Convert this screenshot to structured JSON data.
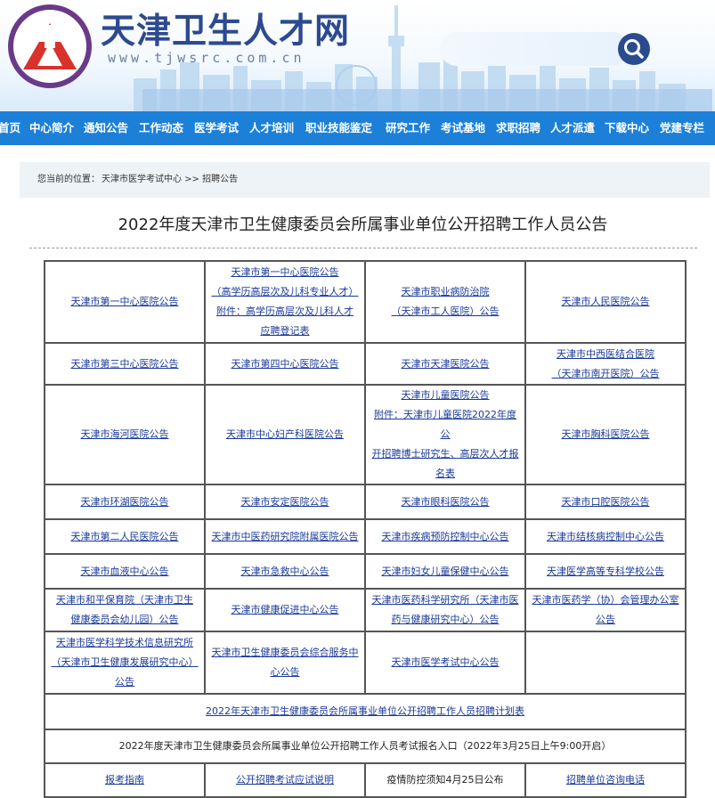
{
  "header": {
    "title": "天津卫生人才网",
    "url": "www.tjwsrc.com.cn"
  },
  "colors": {
    "nav_bg": "#1c80d8",
    "link": "#1a3a9a",
    "logo_ring": "#c0392b",
    "brand_blue": "#2d4a8f"
  },
  "nav": [
    "首页",
    "中心简介",
    "通知公告",
    "工作动态",
    "医学考试",
    "人才培训",
    "职业技能鉴定",
    "研究工作",
    "考试基地",
    "求职招聘",
    "人才派遣",
    "下载中心",
    "党建专栏"
  ],
  "breadcrumb": {
    "label": "您当前的位置：",
    "path": "天津市医学考试中心 >> 招聘公告"
  },
  "page_title": "2022年度天津市卫生健康委员会所属事业单位公开招聘工作人员公告",
  "grid": {
    "r1": [
      "天津市第一中心医院公告",
      "天津市第一中心医院公告",
      "（高学历高层次及儿科专业人才）",
      "附件：高学历高层次及儿科人才",
      "应聘登记表",
      "天津市职业病防治院",
      "（天津市工人医院）公告",
      "天津市人民医院公告"
    ],
    "r2": [
      "天津市第三中心医院公告",
      "天津市第四中心医院公告",
      "天津市天津医院公告",
      "天津市中西医结合医院",
      "（天津市南开医院）公告"
    ],
    "r3": [
      "天津市海河医院公告",
      "天津市中心妇产科医院公告",
      "天津市儿童医院公告",
      "附件：天津市儿童医院2022年度公",
      "开招聘博士研究生、高层次人才报",
      "名表",
      "天津市胸科医院公告"
    ],
    "r4": [
      "天津市环湖医院公告",
      "天津市安定医院公告",
      "天津市眼科医院公告",
      "天津市口腔医院公告"
    ],
    "r5": [
      "天津市第二人民医院公告",
      "天津市中医药研究院附属医院公告",
      "天津市疾病预防控制中心公告",
      "天津市结核病控制中心公告"
    ],
    "r6": [
      "天津市血液中心公告",
      "天津市急救中心公告",
      "天津市妇女儿童保健中心公告",
      "天津医学高等专科学校公告"
    ],
    "r7": [
      "天津市和平保育院（天津市卫生",
      "健康委员会幼儿园）公告",
      "天津市健康促进中心公告",
      "天津市医药科学研究所（天津市医",
      "药与健康研究中心）公告",
      "天津市医药学（协）会管理办公室",
      "公告"
    ],
    "r8": [
      "天津市医学科学技术信息研究所",
      "（天津市卫生健康发展研究中心）",
      "公告",
      "天津市卫生健康委员会综合服务中",
      "心公告",
      "天津市医学考试中心公告"
    ],
    "plan": "2022年天津市卫生健康委员会所属事业单位公开招聘工作人员招聘计划表",
    "entry": "2022年度天津市卫生健康委员会所属事业单位公开招聘工作人员考试报名入口（2022年3月25日上午9:00开启）",
    "bottom": [
      "报考指南",
      "公开招聘考试应试说明",
      "疫情防控须知4月25日公布",
      "招聘单位咨询电话"
    ]
  }
}
